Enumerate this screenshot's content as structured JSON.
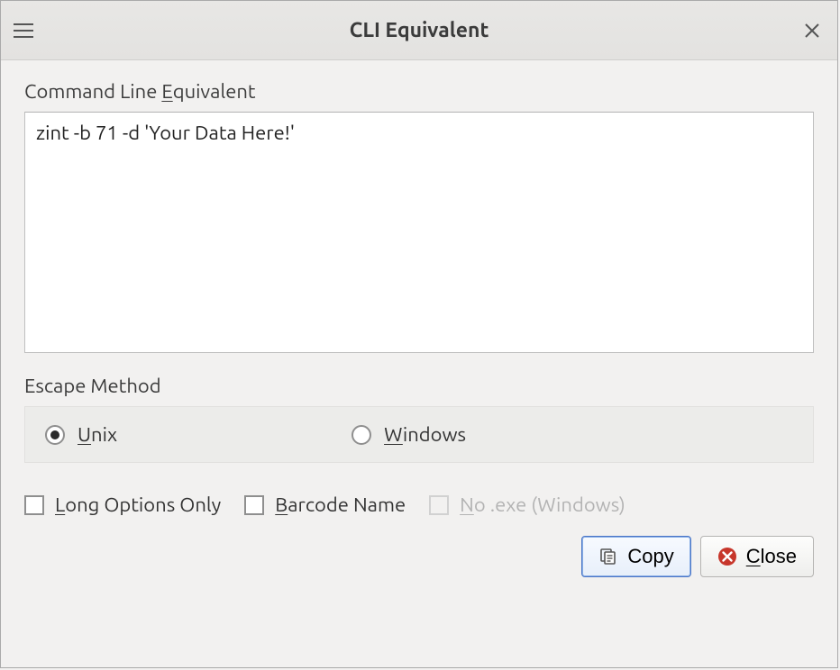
{
  "window": {
    "title": "CLI Equivalent"
  },
  "field": {
    "label_pre": "Command Line ",
    "label_mn": "E",
    "label_post": "quivalent",
    "value": "zint -b 71 -d 'Your Data Here!'"
  },
  "escape": {
    "label": "Escape Method",
    "options": [
      {
        "mn": "U",
        "rest": "nix",
        "checked": true
      },
      {
        "mn": "W",
        "rest": "indows",
        "checked": false
      }
    ]
  },
  "checks": [
    {
      "mn": "L",
      "rest": "ong Options Only",
      "checked": false,
      "disabled": false
    },
    {
      "mn": "B",
      "rest": "arcode Name",
      "checked": false,
      "disabled": false
    },
    {
      "mn": "N",
      "rest": "o .exe (Windows)",
      "checked": false,
      "disabled": true
    }
  ],
  "buttons": {
    "copy": {
      "label": "Copy"
    },
    "close": {
      "mn": "C",
      "rest": "lose"
    }
  }
}
